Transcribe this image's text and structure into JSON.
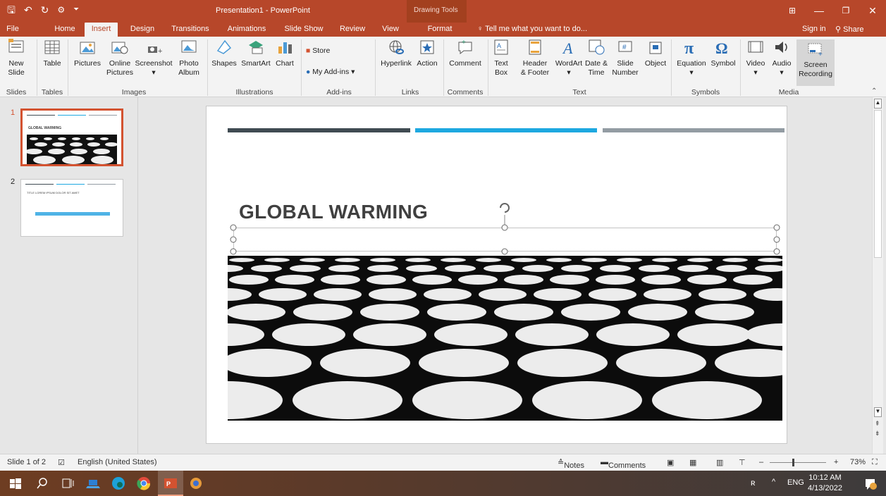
{
  "app": {
    "window_title": "Presentation1 - PowerPoint",
    "contextual_group": "Drawing Tools"
  },
  "tabs": [
    {
      "label": "File",
      "active": false
    },
    {
      "label": "Home",
      "active": false
    },
    {
      "label": "Insert",
      "active": true
    },
    {
      "label": "Design",
      "active": false
    },
    {
      "label": "Transitions",
      "active": false
    },
    {
      "label": "Animations",
      "active": false
    },
    {
      "label": "Slide Show",
      "active": false
    },
    {
      "label": "Review",
      "active": false
    },
    {
      "label": "View",
      "active": false
    },
    {
      "label": "Format",
      "active": false
    }
  ],
  "tell_me": "Tell me what you want to do...",
  "signin": "Sign in",
  "share": "Share",
  "ribbon": {
    "buttons": {
      "new_slide": "New\nSlide",
      "table": "Table",
      "pictures": "Pictures",
      "online_pictures": "Online\nPictures",
      "screenshot": "Screenshot",
      "photo_album": "Photo\nAlbum",
      "shapes": "Shapes",
      "smartart": "SmartArt",
      "chart": "Chart",
      "store": "Store",
      "my_addins": "My Add-ins",
      "hyperlink": "Hyperlink",
      "action": "Action",
      "comment": "Comment",
      "text_box": "Text\nBox",
      "header_footer": "Header\n& Footer",
      "wordart": "WordArt",
      "date_time": "Date &\nTime",
      "slide_number": "Slide\nNumber",
      "object": "Object",
      "equation": "Equation",
      "symbol": "Symbol",
      "video": "Video",
      "audio": "Audio",
      "screen_recording": "Screen\nRecording"
    },
    "groups": {
      "slides": "Slides",
      "tables": "Tables",
      "images": "Images",
      "illustrations": "Illustrations",
      "addins": "Add-ins",
      "links": "Links",
      "comments": "Comments",
      "text": "Text",
      "symbols": "Symbols",
      "media": "Media"
    }
  },
  "thumbnails": [
    {
      "number": "1",
      "title": "GLOBAL WARMING",
      "selected": true
    },
    {
      "number": "2",
      "title": "TITLE LOREM IPSUM DOLOR SIT AMET",
      "selected": false
    }
  ],
  "slide": {
    "title": "GLOBAL WARMING",
    "accent_colors": [
      "#404b52",
      "#1ea8e0",
      "#939ca3"
    ]
  },
  "status": {
    "slide_info": "Slide 1 of 2",
    "language": "English (United States)",
    "notes": "Notes",
    "comments": "Comments",
    "zoom": "73%"
  },
  "taskbar": {
    "language": "ENG",
    "time": "10:12 AM",
    "date": "4/13/2022"
  }
}
